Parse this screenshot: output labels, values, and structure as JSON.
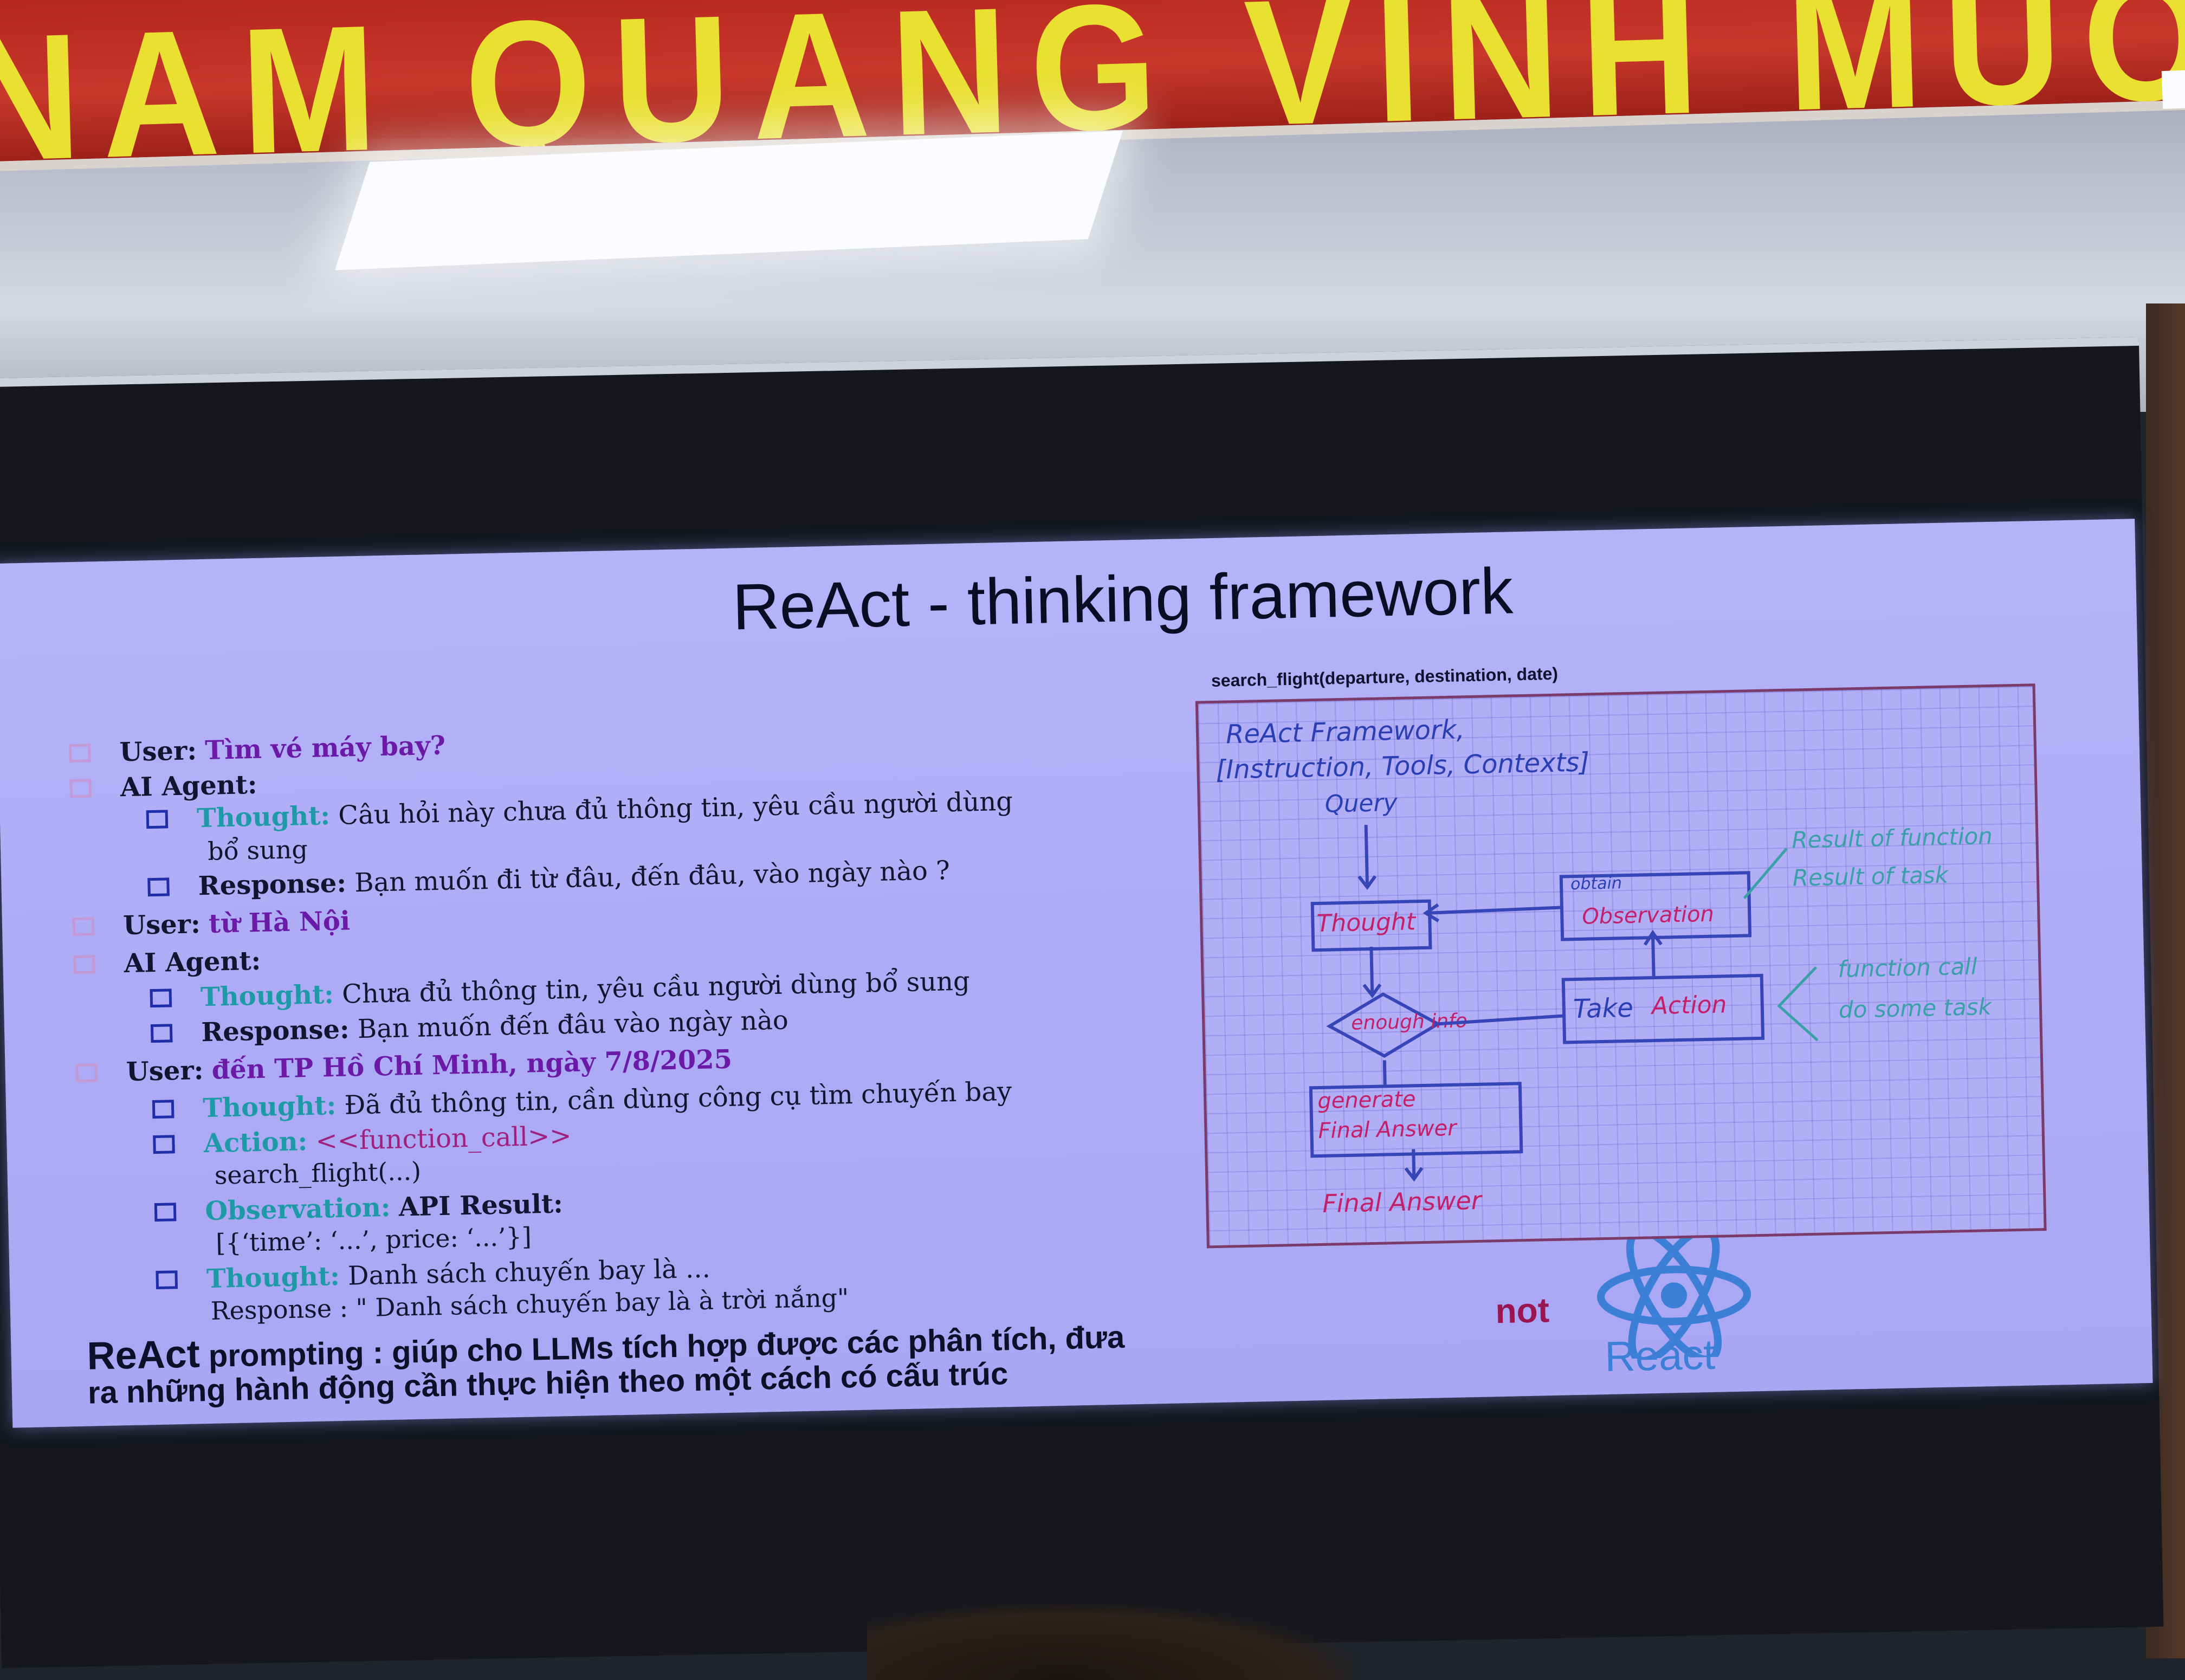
{
  "banner": {
    "text": "NAM QUANG VINH MUÔN"
  },
  "slide": {
    "title": "ReAct - thinking framework",
    "dialog": [
      {
        "id": "u1",
        "label": "User:",
        "value": "Tìm vé máy bay?"
      },
      {
        "id": "a1",
        "label": "AI Agent:"
      },
      {
        "id": "a1t",
        "label": "Thought:",
        "value": "Câu hỏi này chưa đủ thông tin, yêu cầu người dùng",
        "cont": "bổ sung"
      },
      {
        "id": "a1r",
        "label": "Response:",
        "value": "Bạn muốn đi từ đâu, đến đâu, vào ngày nào ?"
      },
      {
        "id": "u2",
        "label": "User:",
        "value": "từ Hà Nội"
      },
      {
        "id": "a2",
        "label": "AI Agent:"
      },
      {
        "id": "a2t",
        "label": "Thought:",
        "value": "Chưa đủ thông tin, yêu cầu người dùng bổ sung"
      },
      {
        "id": "a2r",
        "label": "Response:",
        "value": "Bạn muốn đến đâu vào ngày nào"
      },
      {
        "id": "u3",
        "label": "User:",
        "value": "đến TP Hồ Chí Minh,  ngày 7/8/2025"
      },
      {
        "id": "a3t",
        "label": "Thought:",
        "value": "Đã đủ thông tin, cần dùng công cụ tìm chuyến bay"
      },
      {
        "id": "a3a",
        "label": "Action:",
        "value": "<<function_call>>",
        "cont": "search_flight(...)"
      },
      {
        "id": "a3o",
        "label": "Observation:",
        "value": "API Result:",
        "cont": "[{‘time’: ‘...’, price: ‘...’}]"
      },
      {
        "id": "a3t2",
        "label": "Thought:",
        "value": "Danh sách chuyến bay là ...",
        "cont": "Response : \" Danh sách chuyến bay là à trời nắng\""
      }
    ],
    "summary": {
      "lead": "ReAct",
      "line1": "prompting : giúp cho LLMs tích hợp được các phân tích, đưa",
      "line2": "ra những hành động cần thực hiện theo một cách có cấu trúc"
    },
    "not_label": "not",
    "react_logo_label": "React",
    "diagram": {
      "caption": "search_flight(departure, destination, date)",
      "heading": "ReAct Framework,",
      "inputs": "[Instruction, Tools, Contexts]",
      "query": "Query",
      "thought": "Thought",
      "obtain": "obtain",
      "observation": "Observation",
      "enough": "enough info",
      "take": "Take",
      "action": "Action",
      "generate": "generate",
      "final_box": "Final Answer",
      "final": "Final Answer",
      "note_obs1": "Result of function",
      "note_obs2": "Result of task",
      "note_act1": "function call",
      "note_act2": "do some task"
    },
    "colors": {
      "background": "#b0aef6",
      "keyword": "#1e9aa7",
      "user_value": "#6a1aa7",
      "action_value": "#a0207e"
    }
  }
}
